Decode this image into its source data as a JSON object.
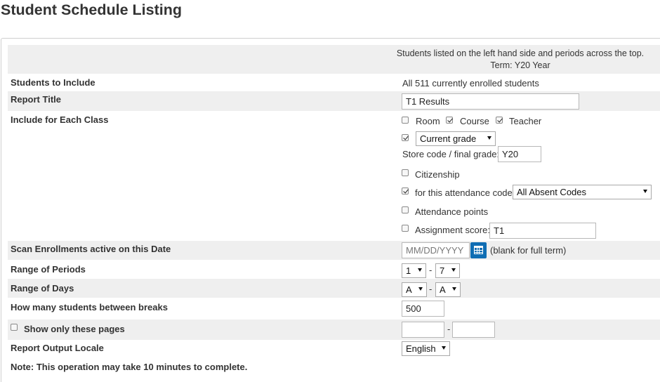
{
  "page": {
    "title": "Student Schedule Listing"
  },
  "header_note": {
    "line1": "Students listed on the left hand side and periods across the top.",
    "line2": "Term: Y20 Year"
  },
  "students_to_include": {
    "label": "Students to Include",
    "value": "All 511 currently enrolled students"
  },
  "report_title": {
    "label": "Report Title",
    "value": "T1 Results"
  },
  "include_for_each_class": {
    "label": "Include for Each Class",
    "room": {
      "label": "Room",
      "checked": false
    },
    "course": {
      "label": "Course",
      "checked": true
    },
    "teacher": {
      "label": "Teacher",
      "checked": true
    },
    "grade": {
      "checked": true,
      "selected": "Current grade"
    },
    "store_code": {
      "label": "Store code / final grade:",
      "value": "Y20"
    },
    "citizenship": {
      "label": "Citizenship",
      "checked": false
    },
    "attendance_code": {
      "label": "for this attendance code",
      "checked": true,
      "selected": "All Absent Codes"
    },
    "attendance_points": {
      "label": "Attendance points",
      "checked": false
    },
    "assignment_score": {
      "label": "Assignment score:",
      "checked": false,
      "value": "T1"
    }
  },
  "scan_enrollments": {
    "label": "Scan Enrollments active on this Date",
    "placeholder": "MM/DD/YYYY",
    "hint": "(blank for full term)"
  },
  "range_of_periods": {
    "label": "Range of Periods",
    "from": "1",
    "to": "7",
    "separator": "-"
  },
  "range_of_days": {
    "label": "Range of Days",
    "from": "A",
    "to": "A",
    "separator": "-"
  },
  "students_between_breaks": {
    "label": "How many students between breaks",
    "value": "500"
  },
  "show_only_pages": {
    "label": "Show only these pages",
    "checked": false,
    "from": "",
    "to": "",
    "separator": "-"
  },
  "report_output_locale": {
    "label": "Report Output Locale",
    "selected": "English"
  },
  "footer_note": "Note: This operation may take 10 minutes to complete.",
  "colors": {
    "row_shade": "#efefef",
    "calendar_button": "#0f6db3"
  }
}
